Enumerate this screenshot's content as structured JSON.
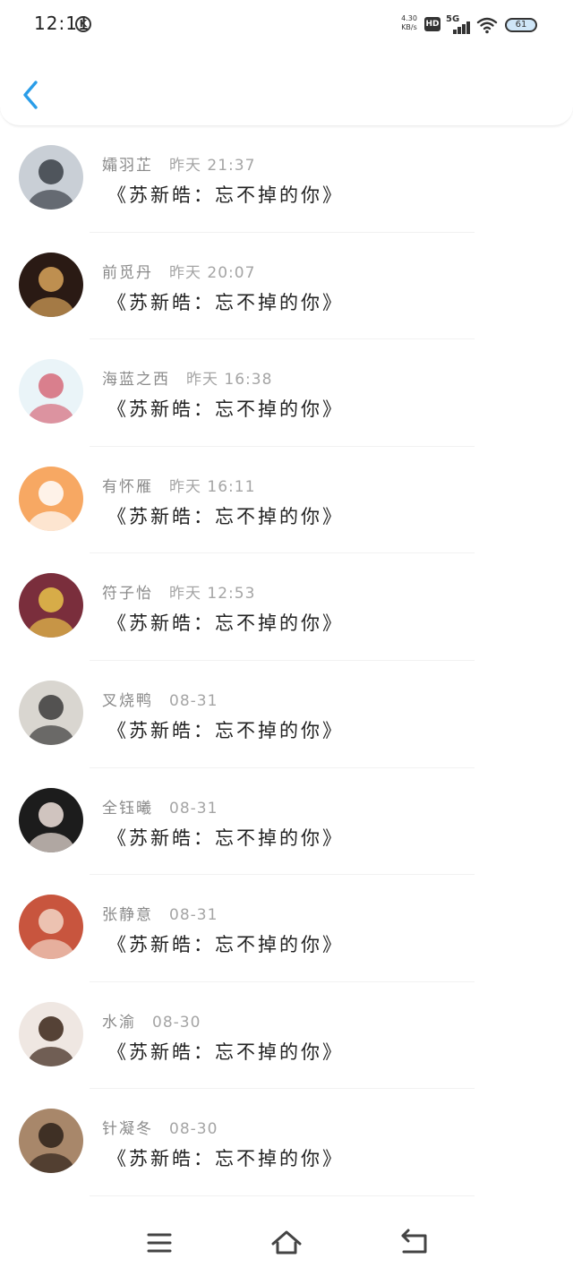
{
  "status_bar": {
    "time": "12:11",
    "k_badge": "K",
    "net_speed_value": "4.30",
    "net_speed_unit": "KB/s",
    "hd_badge": "HD",
    "network": "5G",
    "battery": "61"
  },
  "header": {
    "back_icon": "chevron-left-icon"
  },
  "list": [
    {
      "name": "孀羽芷",
      "time": "昨天 21:37",
      "message": "《苏新皓：忘不掉的你》",
      "avatar_colors": [
        "#c9cfd6",
        "#3a3f47"
      ]
    },
    {
      "name": "前觅丹",
      "time": "昨天 20:07",
      "message": "《苏新皓：忘不掉的你》",
      "avatar_colors": [
        "#2a1a14",
        "#d8a45a"
      ]
    },
    {
      "name": "海蓝之西",
      "time": "昨天 16:38",
      "message": "《苏新皓：忘不掉的你》",
      "avatar_colors": [
        "#eaf4f8",
        "#d66a7a"
      ]
    },
    {
      "name": "有怀雁",
      "time": "昨天 16:11",
      "message": "《苏新皓：忘不掉的你》",
      "avatar_colors": [
        "#f7a863",
        "#ffffff"
      ]
    },
    {
      "name": "符子怡",
      "time": "昨天 12:53",
      "message": "《苏新皓：忘不掉的你》",
      "avatar_colors": [
        "#7a2e3c",
        "#e8c24a"
      ]
    },
    {
      "name": "叉烧鸭",
      "time": "08-31",
      "message": "《苏新皓：忘不掉的你》",
      "avatar_colors": [
        "#d9d6d0",
        "#3b3b3b"
      ]
    },
    {
      "name": "全钰曦",
      "time": "08-31",
      "message": "《苏新皓：忘不掉的你》",
      "avatar_colors": [
        "#1c1c1c",
        "#f0e2dc"
      ]
    },
    {
      "name": "张静意",
      "time": "08-31",
      "message": "《苏新皓：忘不掉的你》",
      "avatar_colors": [
        "#c8553e",
        "#f2d6c6"
      ]
    },
    {
      "name": "水渝",
      "time": "08-30",
      "message": "《苏新皓：忘不掉的你》",
      "avatar_colors": [
        "#efe7e2",
        "#3a2418"
      ]
    },
    {
      "name": "针凝冬",
      "time": "08-30",
      "message": "《苏新皓：忘不掉的你》",
      "avatar_colors": [
        "#a8876a",
        "#2d2119"
      ]
    }
  ],
  "nav": {
    "menu_icon": "menu-icon",
    "home_icon": "home-icon",
    "back_icon": "return-icon"
  },
  "colors": {
    "accent": "#2a9de8",
    "name_text": "#8a8a8a",
    "message_text": "#222222"
  }
}
